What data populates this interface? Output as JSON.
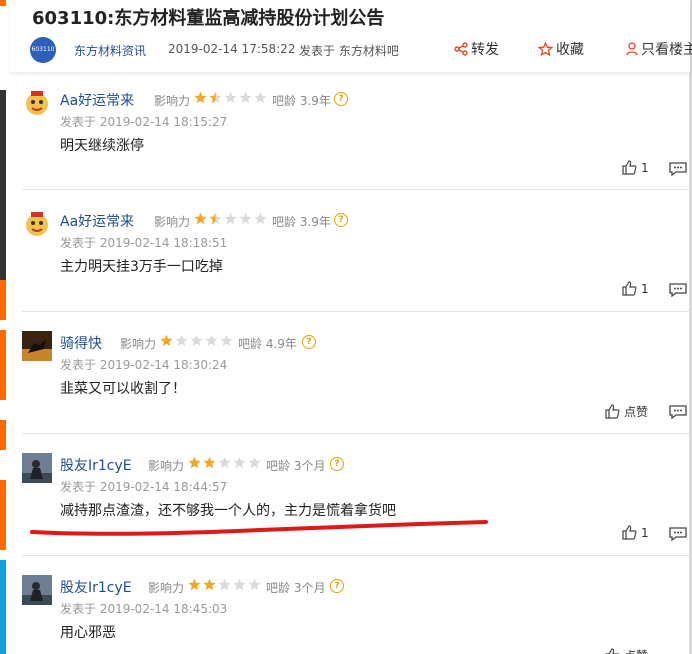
{
  "article": {
    "title": "603110:东方材料董监高减持股份计划公告",
    "source_logo_text": "603110",
    "source_name": "东方材料资讯",
    "date": "2019-02-14 17:58:22",
    "posted_in": "发表于 东方材料吧"
  },
  "actions": {
    "share": "转发",
    "favorite": "收藏",
    "author_only": "只看楼主"
  },
  "labels": {
    "influence": "影响力",
    "bar_age": "吧龄"
  },
  "comments": [
    {
      "user": "Aa好运常来",
      "influence_stars": 1.5,
      "bar_age": "3.9年",
      "time": "发表于 2019-02-14 18:15:27",
      "text": "明天继续涨停",
      "likes": "1"
    },
    {
      "user": "Aa好运常来",
      "influence_stars": 1.5,
      "bar_age": "3.9年",
      "time": "发表于 2019-02-14 18:18:51",
      "text": "主力明天挂3万手一口吃掉",
      "likes": "1"
    },
    {
      "user": "骑得快",
      "influence_stars": 1,
      "bar_age": "4.9年",
      "time": "发表于 2019-02-14 18:30:24",
      "text": "韭菜又可以收割了！",
      "likes": "点赞"
    },
    {
      "user": "股友Ir1cyE",
      "influence_stars": 2,
      "bar_age": "3个月",
      "time": "发表于 2019-02-14 18:44:57",
      "text": "减持那点渣渣，还不够我一个人的，主力是慌着拿货吧",
      "likes": "1"
    },
    {
      "user": "股友Ir1cyE",
      "influence_stars": 2,
      "bar_age": "3个月",
      "time": "发表于 2019-02-14 18:45:03",
      "text": "用心邪恶",
      "likes": "点赞"
    }
  ],
  "colors": {
    "accent_orange": "#ff6a00",
    "link_blue": "#1f4f8f",
    "star_gold": "#f5a623",
    "annotation_red": "#e01818"
  }
}
